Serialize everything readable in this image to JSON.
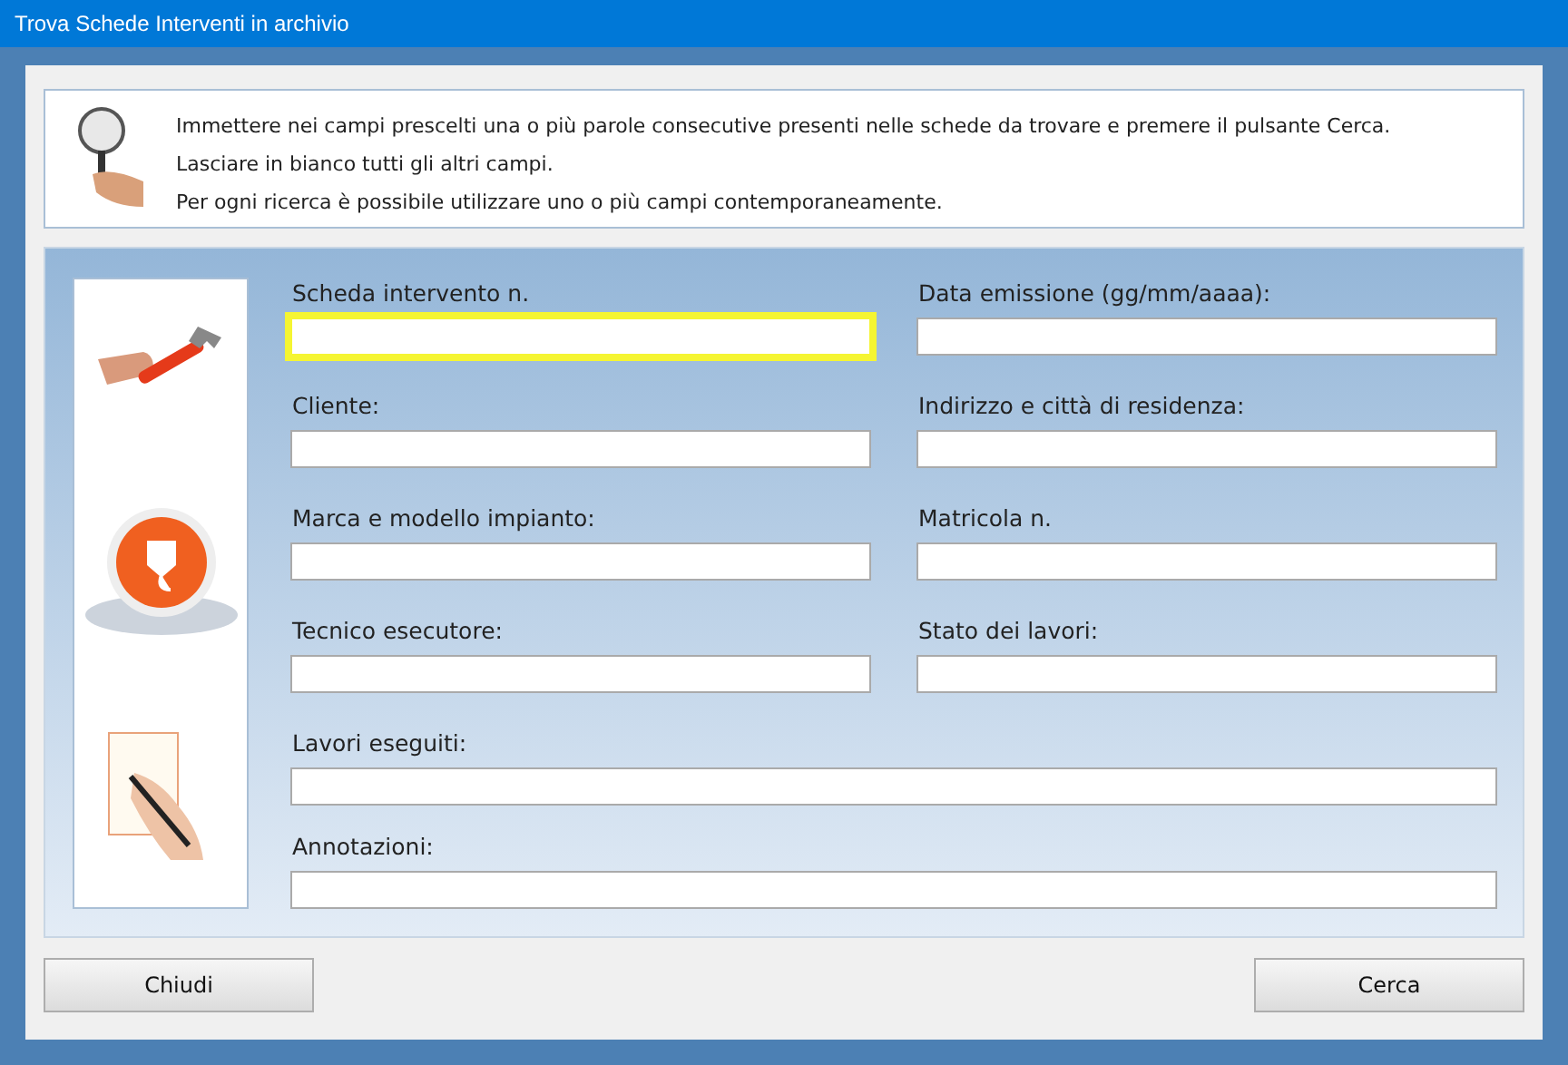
{
  "window": {
    "title": "Trova Schede Interventi in archivio"
  },
  "instructions": [
    "Immettere nei campi prescelti una o più parole consecutive presenti nelle schede da trovare e premere il pulsante Cerca.",
    "Lasciare in bianco tutti gli altri campi.",
    "Per ogni ricerca è possibile utilizzare uno o più campi contemporaneamente."
  ],
  "fields": [
    {
      "label": "Scheda intervento n.",
      "kind": "half",
      "focused": true
    },
    {
      "label": "Data emissione (gg/mm/aaaa):",
      "kind": "half",
      "focused": false
    },
    {
      "label": "Cliente:",
      "kind": "half",
      "focused": false
    },
    {
      "label": "Indirizzo e città di residenza:",
      "kind": "half",
      "focused": false
    },
    {
      "label": "Marca e modello impianto:",
      "kind": "half",
      "focused": false
    },
    {
      "label": "Matricola n.",
      "kind": "half",
      "focused": false
    },
    {
      "label": "Tecnico esecutore:",
      "kind": "half",
      "focused": false
    },
    {
      "label": "Stato dei lavori:",
      "kind": "half",
      "focused": false
    },
    {
      "label": "Lavori eseguiti:",
      "kind": "full",
      "focused": false
    },
    {
      "label": "Annotazioni:",
      "kind": "full",
      "focused": false
    }
  ],
  "buttons": [
    {
      "label": "Chiudi"
    },
    {
      "label": "Cerca"
    }
  ]
}
